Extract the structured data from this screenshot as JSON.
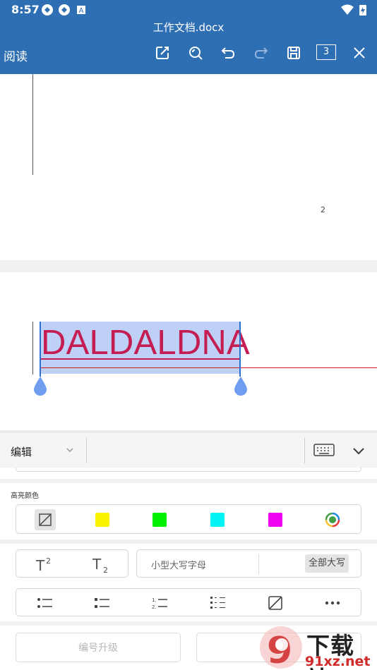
{
  "status_bar": {
    "time": "8:57"
  },
  "header": {
    "doc_title": "工作文档.docx",
    "mode_label": "阅读",
    "page_count": "3"
  },
  "document": {
    "page1_number": "2",
    "selected_text": "DALDALDNA"
  },
  "edit_bar": {
    "label": "编辑"
  },
  "highlight": {
    "title": "高亮颜色",
    "colors": [
      "#fbf400",
      "#00f000",
      "#00f3f3",
      "#f000f0"
    ]
  },
  "format": {
    "small_caps": "小型大写字母",
    "all_caps": "全部大写"
  },
  "list_buttons": {
    "promote": "编号升级"
  },
  "watermark": {
    "brand": "下载站",
    "url": "91xz.net",
    "logo_digit": "9"
  },
  "colors": {
    "header_bg": "#2e6fb4",
    "selection": "#bfd0f7",
    "selected_text": "#c41d52",
    "handle": "#6f9ef0"
  }
}
